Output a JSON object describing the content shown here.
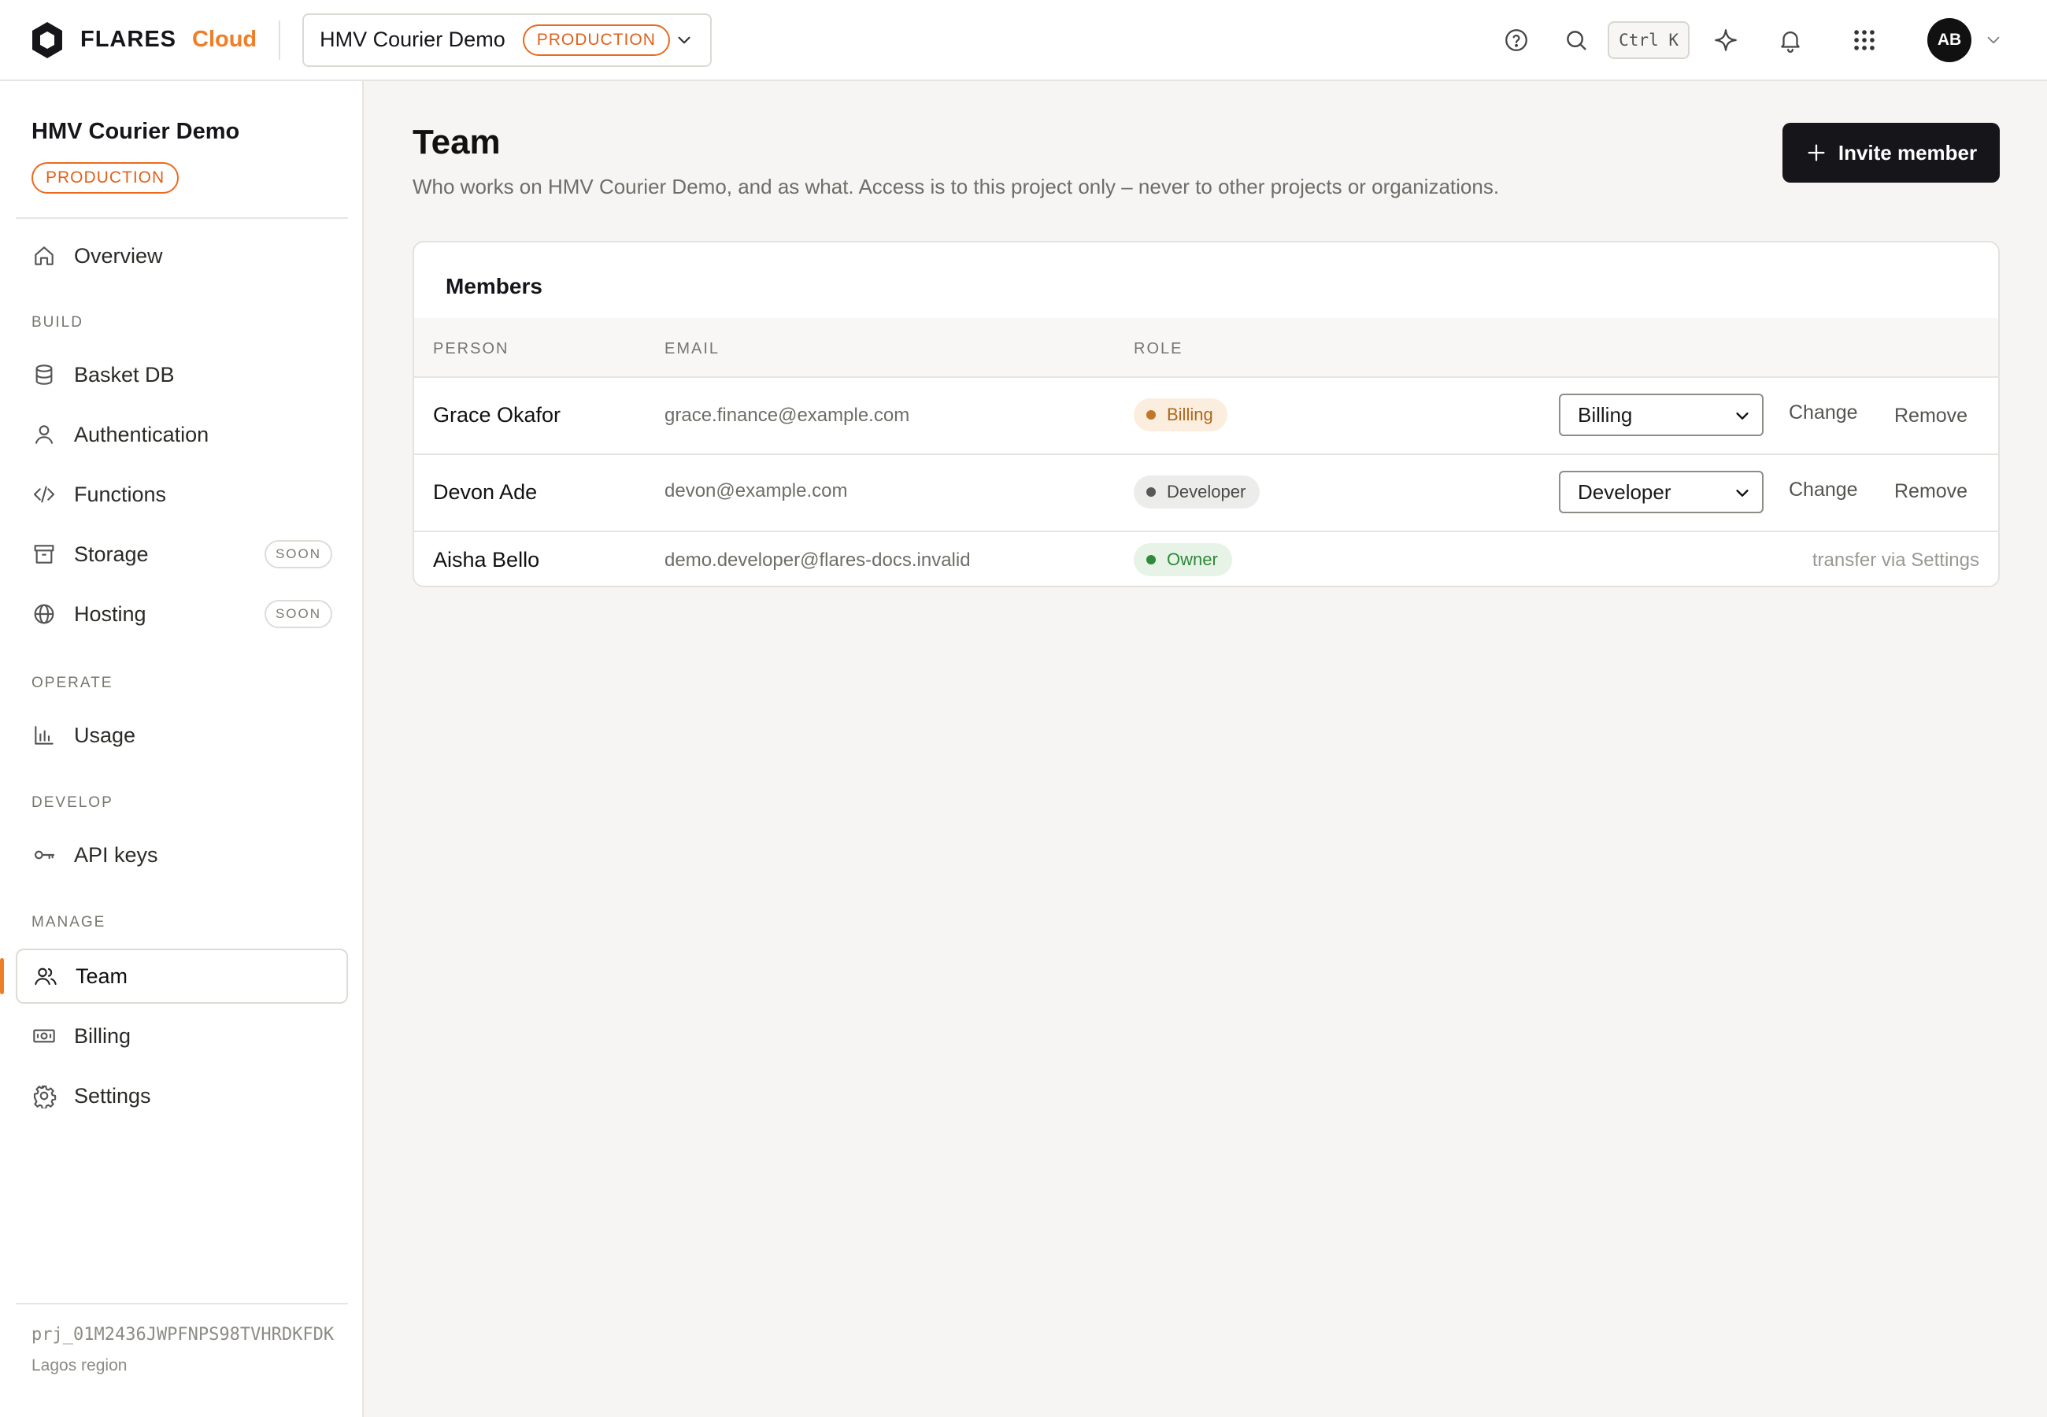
{
  "topbar": {
    "brand_name": "FLARES",
    "brand_suffix": "Cloud",
    "project_name": "HMV Courier Demo",
    "env_badge": "PRODUCTION",
    "shortcut": "Ctrl K",
    "avatar_initials": "AB",
    "icons": [
      "help-icon",
      "search-icon",
      "sparkle-icon",
      "bell-icon",
      "apps-grid-icon",
      "chevron-down-icon"
    ]
  },
  "sidebar": {
    "project_name": "HMV Courier Demo",
    "env_badge": "PRODUCTION",
    "overview": "Overview",
    "sections": {
      "build": "BUILD",
      "operate": "OPERATE",
      "develop": "DEVELOP",
      "manage": "MANAGE"
    },
    "items": {
      "basket_db": "Basket DB",
      "authentication": "Authentication",
      "functions": "Functions",
      "storage": "Storage",
      "hosting": "Hosting",
      "usage": "Usage",
      "api_keys": "API keys",
      "team": "Team",
      "billing": "Billing",
      "settings": "Settings"
    },
    "soon_label": "SOON",
    "project_id": "prj_01M2436JWPFNPS98TVHRDKFDK",
    "region": "Lagos region"
  },
  "main": {
    "title": "Team",
    "subtitle": "Who works on HMV Courier Demo, and as what. Access is to this project only – never to other projects or organizations.",
    "invite_button": "Invite member",
    "card_title": "Members",
    "columns": {
      "person": "PERSON",
      "email": "EMAIL",
      "role": "ROLE"
    },
    "members": [
      {
        "name": "Grace Okafor",
        "email": "grace.finance@example.com",
        "role": "Billing",
        "selected_role": "Billing",
        "change": "Change",
        "remove": "Remove"
      },
      {
        "name": "Devon Ade",
        "email": "devon@example.com",
        "role": "Developer",
        "selected_role": "Developer",
        "change": "Change",
        "remove": "Remove"
      },
      {
        "name": "Aisha Bello",
        "email": "demo.developer@flares-docs.invalid",
        "role": "Owner",
        "note": "transfer via Settings"
      }
    ]
  },
  "colors": {
    "accent": "#f07e26",
    "production": "#e2611a",
    "primary_button": "#16161a",
    "billing_badge": "#b0661a",
    "developer_badge": "#4a4945",
    "owner_badge": "#2f8a3a"
  }
}
